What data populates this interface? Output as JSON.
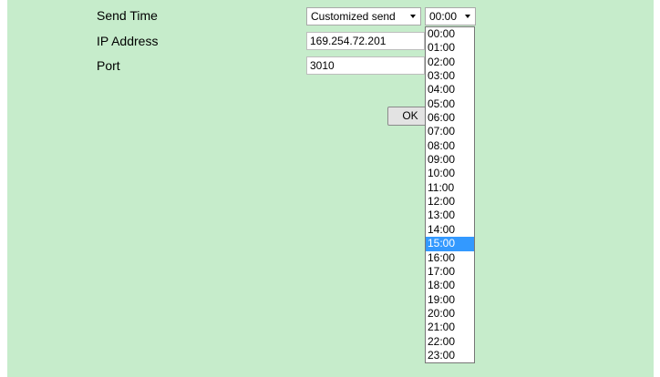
{
  "form": {
    "send_time_label": "Send Time",
    "ip_address_label": "IP Address",
    "port_label": "Port",
    "send_mode_value": "Customized send",
    "time_value": "00:00",
    "ip_address_value": "169.254.72.201",
    "port_value": "3010",
    "ok_label": "OK"
  },
  "dropdown": {
    "options": [
      "00:00",
      "01:00",
      "02:00",
      "03:00",
      "04:00",
      "05:00",
      "06:00",
      "07:00",
      "08:00",
      "09:00",
      "10:00",
      "11:00",
      "12:00",
      "13:00",
      "14:00",
      "15:00",
      "16:00",
      "17:00",
      "18:00",
      "19:00",
      "20:00",
      "21:00",
      "22:00",
      "23:00"
    ],
    "highlighted": "15:00"
  },
  "colors": {
    "background": "#c6eccb",
    "highlight": "#3399ff"
  }
}
